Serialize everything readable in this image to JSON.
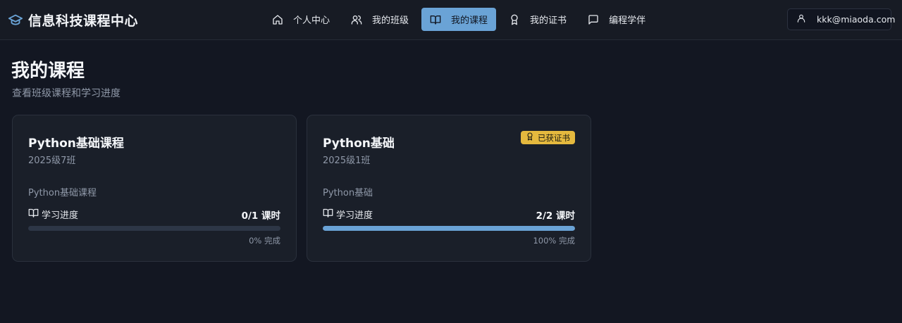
{
  "header": {
    "title": "信息科技课程中心",
    "nav": [
      {
        "label": "个人中心",
        "icon": "home-icon",
        "active": false
      },
      {
        "label": "我的班级",
        "icon": "users-icon",
        "active": false
      },
      {
        "label": "我的课程",
        "icon": "book-open-icon",
        "active": true
      },
      {
        "label": "我的证书",
        "icon": "award-icon",
        "active": false
      },
      {
        "label": "编程学伴",
        "icon": "message-icon",
        "active": false
      }
    ],
    "user": {
      "email": "kkk@miaoda.com",
      "icon": "user-icon"
    }
  },
  "page": {
    "title": "我的课程",
    "subtitle": "查看班级课程和学习进度"
  },
  "courses": [
    {
      "name": "Python基础课程",
      "class": "2025级7班",
      "description": "Python基础课程",
      "progress_label": "学习进度",
      "progress_count": "0/1 课时",
      "progress_fraction": 0.0,
      "percent_text": "0% 完成",
      "certificate": ""
    },
    {
      "name": "Python基础",
      "class": "2025级1班",
      "description": "Python基础",
      "progress_label": "学习进度",
      "progress_count": "2/2 课时",
      "progress_fraction": 1.0,
      "percent_text": "100% 完成",
      "certificate": "已获证书"
    }
  ],
  "colors": {
    "background": "#131722",
    "accent": "#6aa3d6",
    "badge": "#e5b93e"
  }
}
